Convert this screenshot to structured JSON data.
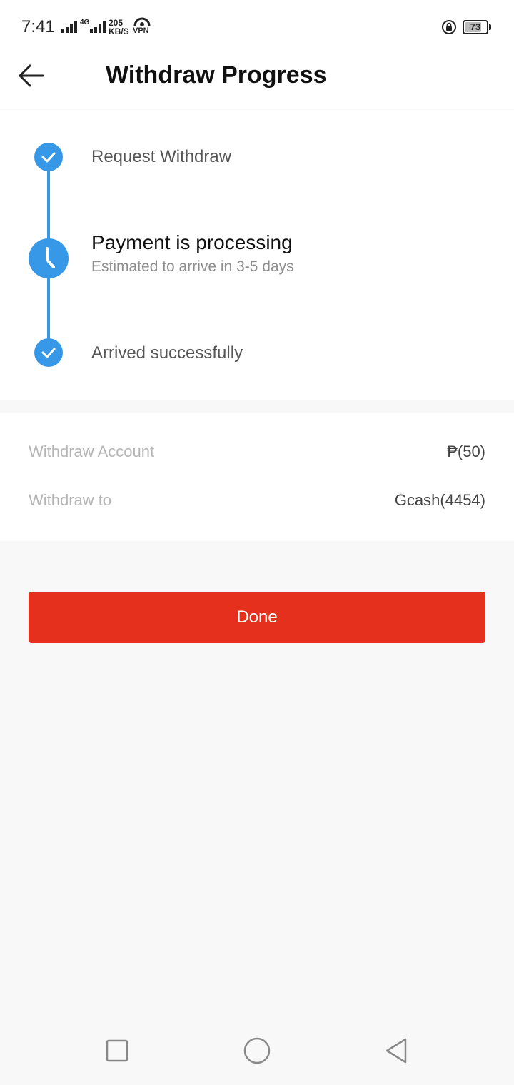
{
  "status_bar": {
    "time": "7:41",
    "network_tag": "4G",
    "speed_value": "205",
    "speed_unit": "KB/S",
    "vpn_label": "VPN",
    "battery_level": "73"
  },
  "header": {
    "title": "Withdraw Progress",
    "back_icon": "arrow-left-icon"
  },
  "progress": {
    "steps": [
      {
        "label": "Request Withdraw",
        "status": "done",
        "icon": "check-icon"
      },
      {
        "label": "Payment is processing",
        "sub": "Estimated to arrive in 3-5 days",
        "status": "current",
        "icon": "clock-icon"
      },
      {
        "label": "Arrived successfully",
        "status": "done",
        "icon": "check-icon"
      }
    ]
  },
  "details": {
    "rows": [
      {
        "label": "Withdraw Account",
        "value": "₱(50)"
      },
      {
        "label": "Withdraw to",
        "value": "Gcash(4454)"
      }
    ]
  },
  "actions": {
    "done_label": "Done"
  },
  "nav": {
    "icons": [
      "square-recents-icon",
      "circle-home-icon",
      "triangle-back-icon"
    ]
  },
  "colors": {
    "accent_blue": "#3898e8",
    "primary_red": "#e4301c",
    "background": "#f8f8f8"
  }
}
